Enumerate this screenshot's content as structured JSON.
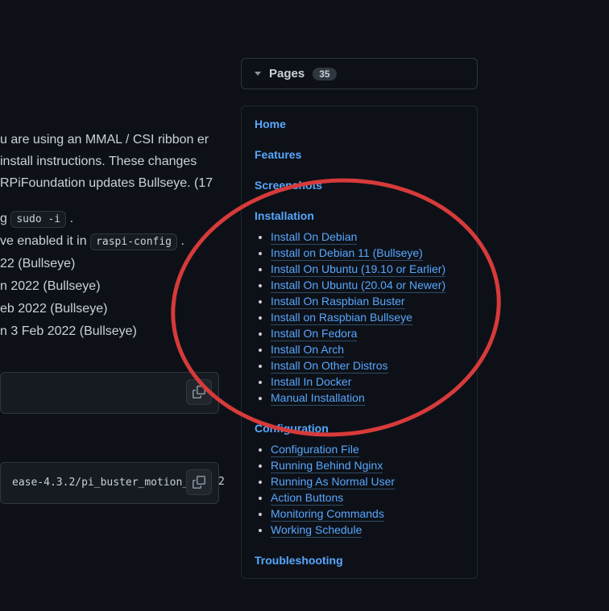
{
  "main": {
    "para1": "u are using an MMAL / CSI ribbon er install instructions. These changes RPiFoundation updates Bullseye. (17",
    "line_code_sudo_pre": "g ",
    "line_code_sudo": "sudo -i",
    "line_code_sudo_post": " .",
    "line_raspi_pre": "ve enabled it in ",
    "line_raspi_code": "raspi-config",
    "line_raspi_post": " .",
    "lines": [
      "22 (Bullseye)",
      "n 2022 (Bullseye)",
      "eb 2022 (Bullseye)",
      "n 3 Feb 2022 (Bullseye)"
    ],
    "codeblock2_text": "ease-4.3.2/pi_buster_motion_",
    "codeblock2_tail": "2"
  },
  "sidebar": {
    "pages_label": "Pages",
    "pages_count": "35",
    "home": "Home",
    "features": "Features",
    "screenshots": "Screenshots",
    "installation": {
      "title": "Installation",
      "items": [
        "Install On Debian",
        "Install on Debian 11 (Bullseye)",
        "Install On Ubuntu (19.10 or Earlier)",
        "Install On Ubuntu (20.04 or Newer)",
        "Install On Raspbian Buster",
        "Install on Raspbian Bullseye",
        "Install On Fedora",
        "Install On Arch",
        "Install On Other Distros",
        "Install In Docker",
        "Manual Installation"
      ]
    },
    "configuration": {
      "title": "Configuration",
      "items": [
        "Configuration File",
        "Running Behind Nginx",
        "Running As Normal User",
        "Action Buttons",
        "Monitoring Commands",
        "Working Schedule"
      ]
    },
    "troubleshooting": "Troubleshooting"
  }
}
